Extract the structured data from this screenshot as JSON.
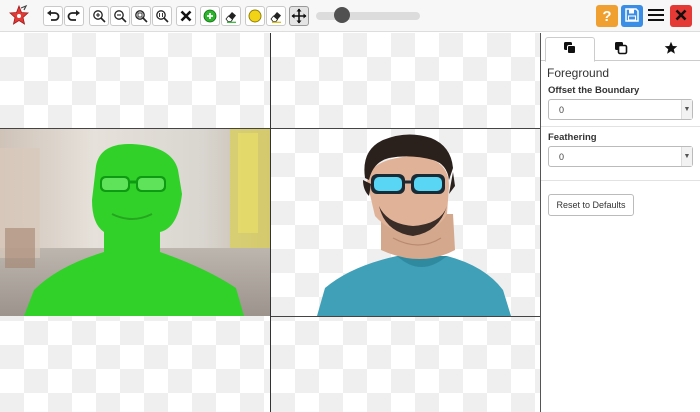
{
  "toolbar": {
    "tools": [
      {
        "name": "undo-icon"
      },
      {
        "name": "redo-icon"
      },
      {
        "name": "zoom-in-icon"
      },
      {
        "name": "zoom-out-icon"
      },
      {
        "name": "zoom-fit-icon"
      },
      {
        "name": "zoom-actual-icon"
      },
      {
        "name": "clear-icon"
      },
      {
        "name": "add-green-icon"
      },
      {
        "name": "eraser-green-icon"
      },
      {
        "name": "yellow-dot-icon"
      },
      {
        "name": "eraser-icon"
      },
      {
        "name": "move-icon"
      }
    ],
    "brush_size": 0.25,
    "right_buttons": {
      "help_label": "?",
      "help_color": "#f0a030",
      "save_color": "#3a8ee6",
      "close_color": "#e53935"
    }
  },
  "sidebar": {
    "tabs": [
      {
        "name": "foreground-tab",
        "active": true
      },
      {
        "name": "background-tab",
        "active": false
      },
      {
        "name": "effects-tab",
        "active": false
      }
    ],
    "section_title": "Foreground",
    "offset_label": "Offset the Boundary",
    "offset_value": "0",
    "feathering_label": "Feathering",
    "feathering_value": "0",
    "reset_label": "Reset to Defaults"
  },
  "colors": {
    "mask_green": "#31d12a",
    "sunglass_blue": "#5ad6f5",
    "shirt_blue": "#3fa0b8"
  }
}
